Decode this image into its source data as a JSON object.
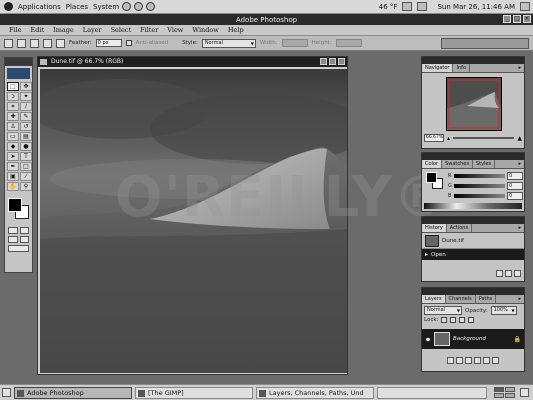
{
  "top_panel": {
    "menus": [
      "Applications",
      "Places",
      "System"
    ],
    "weather": "46 °F",
    "clock": "Sun Mar 26, 11:46 AM"
  },
  "app": {
    "title": "Adobe Photoshop",
    "menu": [
      "File",
      "Edit",
      "Image",
      "Layer",
      "Select",
      "Filter",
      "View",
      "Window",
      "Help"
    ]
  },
  "options": {
    "feather_label": "Feather:",
    "feather_value": "0 px",
    "antialiased_label": "Anti-aliased",
    "style_label": "Style:",
    "style_value": "Normal",
    "width_label": "Width:",
    "height_label": "Height:"
  },
  "document": {
    "title": "Dune.tif @ 66.7% (RGB)",
    "watermark": "O'REILLY®"
  },
  "navigator": {
    "tabs": [
      "Navigator",
      "Info"
    ],
    "zoom": "66.67%"
  },
  "color": {
    "tabs": [
      "Color",
      "Swatches",
      "Styles"
    ],
    "channels": [
      {
        "label": "R",
        "value": "0"
      },
      {
        "label": "G",
        "value": "0"
      },
      {
        "label": "B",
        "value": "0"
      }
    ]
  },
  "history": {
    "tabs": [
      "History",
      "Actions"
    ],
    "snapshot": "Dune.tif",
    "items": [
      "Open"
    ]
  },
  "layers": {
    "tabs": [
      "Layers",
      "Channels",
      "Paths"
    ],
    "blend_mode": "Normal",
    "opacity_label": "Opacity:",
    "opacity_value": "100%",
    "lock_label": "Lock:",
    "layer_name": "Background"
  },
  "taskbar": {
    "items": [
      {
        "label": "Adobe Photoshop",
        "active": true
      },
      {
        "label": "[The GIMP]",
        "active": false
      },
      {
        "label": "Layers, Channels, Paths, Und",
        "active": false
      }
    ]
  }
}
